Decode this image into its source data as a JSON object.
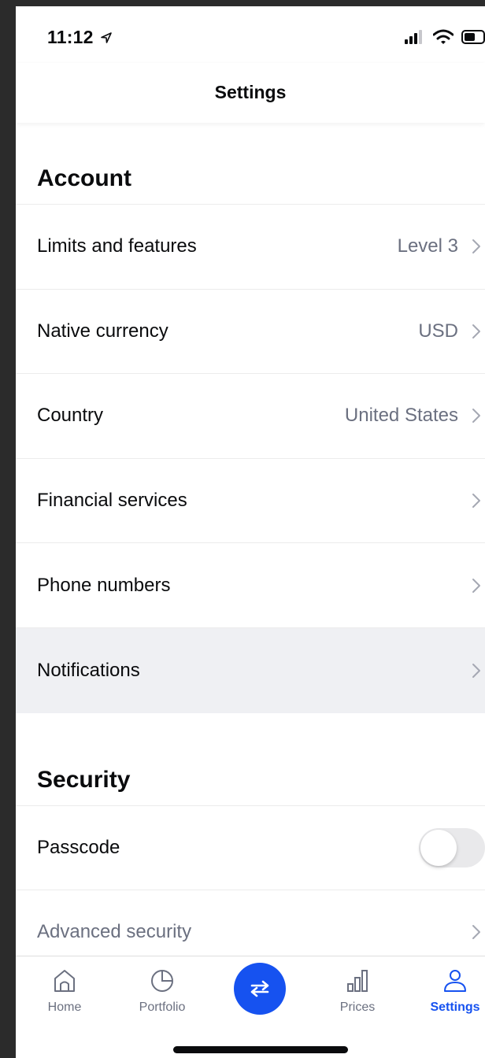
{
  "status_bar": {
    "time": "11:12"
  },
  "nav": {
    "title": "Settings"
  },
  "sections": {
    "account": {
      "title": "Account",
      "rows": [
        {
          "label": "Limits and features",
          "value": "Level 3"
        },
        {
          "label": "Native currency",
          "value": "USD"
        },
        {
          "label": "Country",
          "value": "United States"
        },
        {
          "label": "Financial services",
          "value": ""
        },
        {
          "label": "Phone numbers",
          "value": ""
        },
        {
          "label": "Notifications",
          "value": ""
        }
      ]
    },
    "security": {
      "title": "Security",
      "passcode": {
        "label": "Passcode",
        "enabled": false
      },
      "advanced": {
        "label": "Advanced security"
      }
    }
  },
  "tabs": [
    {
      "label": "Home",
      "icon": "home-icon"
    },
    {
      "label": "Portfolio",
      "icon": "pie-chart-icon"
    },
    {
      "label": "",
      "icon": "swap-arrows-icon"
    },
    {
      "label": "Prices",
      "icon": "bar-chart-icon"
    },
    {
      "label": "Settings",
      "icon": "person-icon",
      "active": true
    }
  ],
  "colors": {
    "accent": "#1652f0",
    "muted_text": "#6b7080",
    "highlight_row": "#eff0f3"
  }
}
